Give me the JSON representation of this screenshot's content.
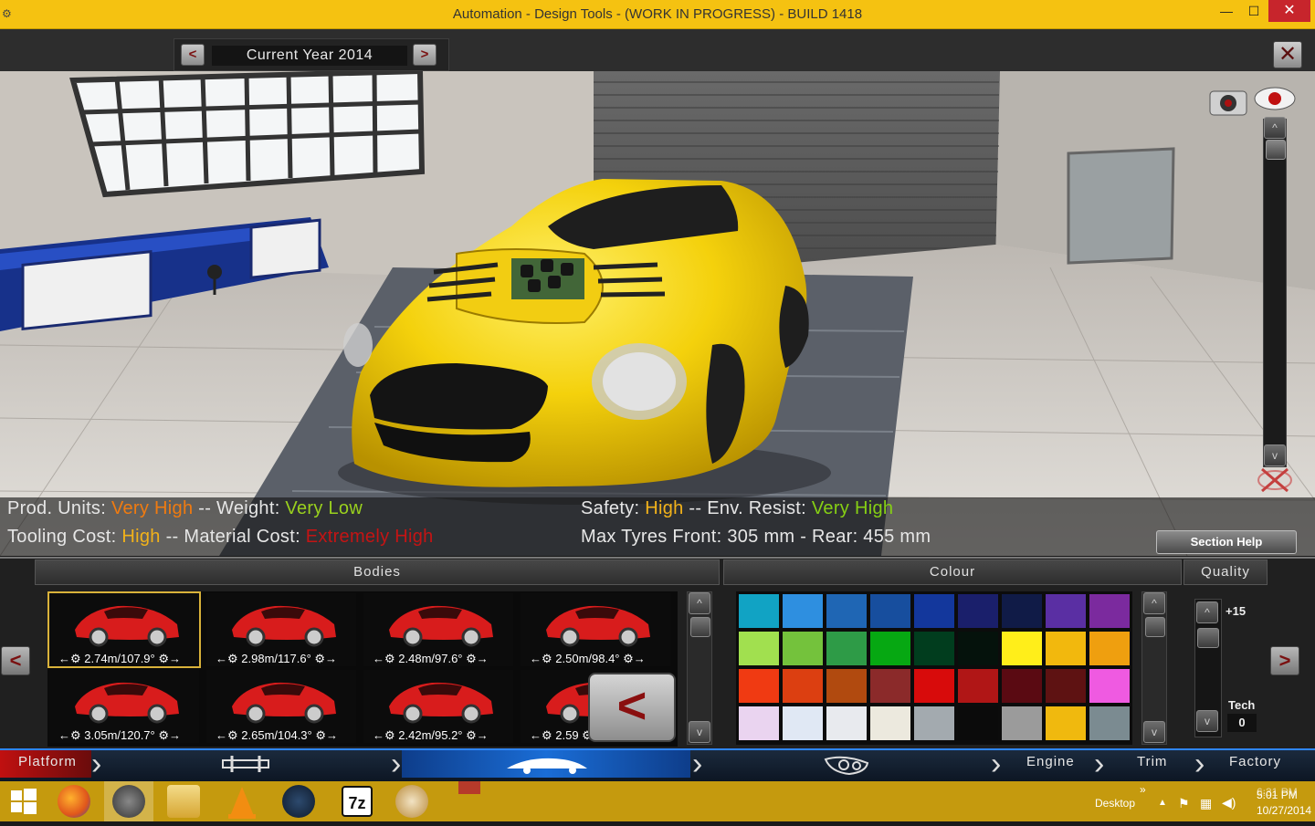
{
  "window": {
    "title": "Automation - Design Tools - (WORK IN PROGRESS) - BUILD 1418",
    "min": "—",
    "max": "☐",
    "close": "✕"
  },
  "topbar": {
    "prev": "<",
    "next": ">",
    "year_label": "Current Year 2014",
    "close": "✕"
  },
  "info": {
    "prod_units_label": "Prod. Units:",
    "prod_units_value": "Very High",
    "sep1": "--",
    "weight_label": "Weight:",
    "weight_value": "Very Low",
    "tooling_label": "Tooling Cost:",
    "tooling_value": "High",
    "sep2": "--",
    "material_label": "Material Cost:",
    "material_value": "Extremely High",
    "safety_label": "Safety:",
    "safety_value": "High",
    "sep3": "--",
    "env_label": "Env. Resist:",
    "env_value": "Very High",
    "tyres_text": "Max Tyres Front: 305 mm - Rear: 455 mm",
    "section_help": "Section Help"
  },
  "scroll": {
    "up": "^",
    "down": "v"
  },
  "bodies": {
    "title": "Bodies",
    "items": [
      {
        "label": "2.74m/107.9°",
        "selected": true
      },
      {
        "label": "2.98m/117.6°",
        "selected": false
      },
      {
        "label": "2.48m/97.6°",
        "selected": false
      },
      {
        "label": "2.50m/98.4°",
        "selected": false
      },
      {
        "label": "3.05m/120.7°",
        "selected": false
      },
      {
        "label": "2.65m/104.3°",
        "selected": false
      },
      {
        "label": "2.42m/95.2°",
        "selected": false
      },
      {
        "label": "2.59",
        "selected": false
      }
    ],
    "collapse": "<",
    "left_arrow": "<"
  },
  "colour": {
    "title": "Colour",
    "swatches": [
      "#11a3c4",
      "#2e8fe0",
      "#1f66b4",
      "#174e9e",
      "#13379c",
      "#1a1f6b",
      "#101b47",
      "#5a2fa3",
      "#7b2a9e",
      "#a1e04f",
      "#74c23c",
      "#2e9b47",
      "#06a812",
      "#013d1e",
      "#05120c",
      "#ffee1a",
      "#f2b80d",
      "#ef9f0f",
      "#f03a12",
      "#dc3f11",
      "#b14a0f",
      "#8b2a2a",
      "#d80b0b",
      "#b01616",
      "#5a0a12",
      "#5e1212",
      "#ef5ae1",
      "#ead4f0",
      "#e0e8f4",
      "#e8eaee",
      "#ece9de",
      "#a3aaaf",
      "#0b0b0b",
      "#9b9b9b",
      "#f0b90e",
      "#7b8b91"
    ]
  },
  "quality": {
    "title": "Quality",
    "value": "+15",
    "tech_label": "Tech",
    "tech_value": "0",
    "right_arrow": ">"
  },
  "nav": {
    "platform": "Platform",
    "engine": "Engine",
    "trim": "Trim",
    "factory": "Factory"
  },
  "taskbar": {
    "desktop": "Desktop",
    "time_a": "6:31 PM",
    "time_b": "5:01 PM",
    "date": "10/27/2014",
    "chevrons": "»"
  }
}
